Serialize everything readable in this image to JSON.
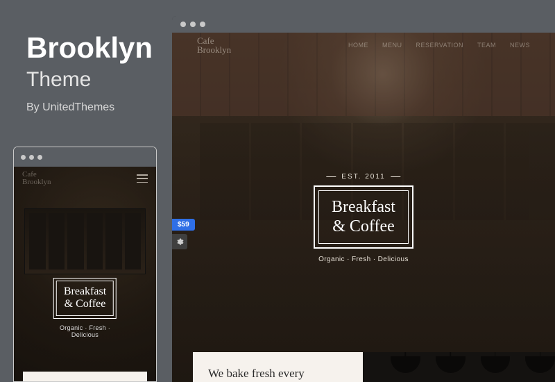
{
  "header": {
    "title": "Brooklyn",
    "subtitle": "Theme",
    "byline": "By UnitedThemes"
  },
  "site": {
    "brand_line1": "Cafe",
    "brand_line2": "Brooklyn",
    "est": "EST. 2011",
    "logo_line1": "Breakfast",
    "logo_line2": "& Coffee",
    "tagline": "Organic · Fresh · Delicious",
    "nav": [
      "HOME",
      "MENU",
      "RESERVATION",
      "TEAM",
      "NEWS"
    ]
  },
  "card": {
    "heading": "We bake fresh every"
  },
  "badges": {
    "price": "$59"
  }
}
